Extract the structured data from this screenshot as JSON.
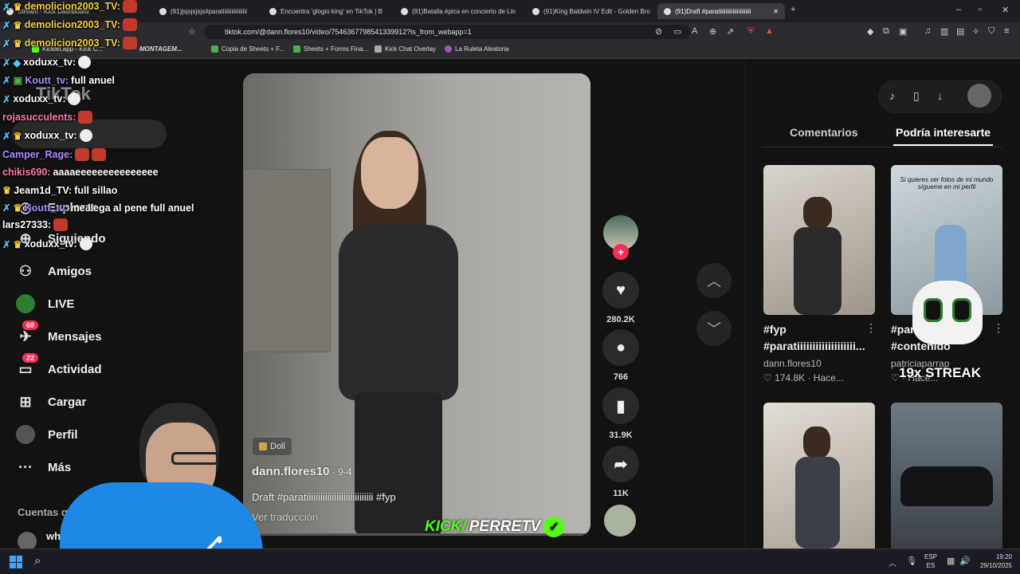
{
  "tabs": [
    {
      "label": "Stream - Kick Dashboard"
    },
    {
      "label": "(91)jsjsjsjsjs#paratiiiiiiiiiiiiiiiii"
    },
    {
      "label": "Encuentra 'glogio king' en TikTok | B"
    },
    {
      "label": "(91)Batalla épica en concierto de Lin"
    },
    {
      "label": "(91)King Baldwin IV Edit - Golden Bro"
    },
    {
      "label": "(91)Draft #paratiiiiiiiiiiiiiiiiiiiiii"
    }
  ],
  "address": {
    "url": "tiktok.com/@dann.flores10/video/7546367798541339912?is_from_webapp=1"
  },
  "bookmarks": [
    "Kicklet.app - Kick C...",
    "MONTAGEM...",
    "Copia de Sheets + F...",
    "Sheets + Forms Fina...",
    "Kick Chat Overlay",
    "La Ruleta Aleatoria"
  ],
  "chat": [
    {
      "user": "demolicion2003_TV:",
      "msg": "",
      "color": "#f4d03f"
    },
    {
      "user": "demolicion2003_TV:",
      "msg": "",
      "color": "#f4d03f"
    },
    {
      "user": "demolicion2003_TV:",
      "msg": "",
      "color": "#f4d03f"
    },
    {
      "user": "xoduxx_tv:",
      "msg": "",
      "color": "#ffffff"
    },
    {
      "user": "Koutt_tv:",
      "msg": "full anuel",
      "color": "#a78bfa"
    },
    {
      "user": "xoduxx_tv:",
      "msg": "",
      "color": "#ffffff"
    },
    {
      "user": "rojasucculents:",
      "msg": "",
      "color": "#ff7aa8"
    },
    {
      "user": "xoduxx_tv:",
      "msg": "",
      "color": "#ffffff"
    },
    {
      "user": "Camper_Rage:",
      "msg": "",
      "color": "#b388ff"
    },
    {
      "user": "chikis690:",
      "msg": "aaaaeeeeeeeeeeeeeee",
      "color": "#ff7aa8"
    },
    {
      "user": "Jeam1d_TV:",
      "msg": "full sillao",
      "color": "#ffffff"
    },
    {
      "user": "Koutt_tv:",
      "msg": "me llega al pene full anuel",
      "color": "#a78bfa"
    },
    {
      "user": "lars27333:",
      "msg": "",
      "color": "#ffffff"
    },
    {
      "user": "xoduxx_tv:",
      "msg": "",
      "color": "#ffffff"
    }
  ],
  "sidebar": {
    "logo": "TikTok",
    "items": [
      {
        "label": "Explorar"
      },
      {
        "label": "Siguiendo"
      },
      {
        "label": "Amigos"
      },
      {
        "label": "LIVE"
      },
      {
        "label": "Mensajes",
        "badge": "69"
      },
      {
        "label": "Actividad",
        "badge": "22"
      },
      {
        "label": "Cargar"
      },
      {
        "label": "Perfil"
      },
      {
        "label": "Más"
      }
    ],
    "following_header": "Cuentas que",
    "following_user": "whit"
  },
  "video": {
    "sound_tag": "Doll",
    "author": "dann.flores10",
    "date": " · 9-4",
    "caption": "Draft #paratiiiiiiiiiiiiiiiiiiiiiiiiiiiii #fyp",
    "translate": "Ver traducción"
  },
  "actions": [
    {
      "icon": "heart-icon",
      "count": "280.2K"
    },
    {
      "icon": "comment-icon",
      "count": "766"
    },
    {
      "icon": "bookmark-icon",
      "count": "31.9K"
    },
    {
      "icon": "share-icon",
      "count": "11K"
    }
  ],
  "panel": {
    "tab_comments": "Comentarios",
    "tab_interest": "Podría interesarte",
    "cards": [
      {
        "title": "#fyp",
        "subtitle": "#paratiiiiiiiiiiiiiiiiiii...",
        "user": "dann.flores10",
        "stats": "174.8K · Hace..."
      },
      {
        "title": "#parati",
        "subtitle": "#contenido",
        "user": "patriciaparrap",
        "stats": "· Hace...",
        "overlay_text": "Si quieres ver fotos de mi mundo sígueme en mi perfil"
      }
    ]
  },
  "overlay": {
    "streak": "19x STREAK",
    "kick_prefix": "KICK/",
    "kick_name": "PERRETV"
  },
  "taskbar": {
    "lang1": "ESP",
    "lang2": "ES",
    "time": "19:20",
    "date": "29/10/2025"
  },
  "colors": {
    "tiktok_red": "#fe2c55",
    "kick_green": "#53fc18"
  }
}
